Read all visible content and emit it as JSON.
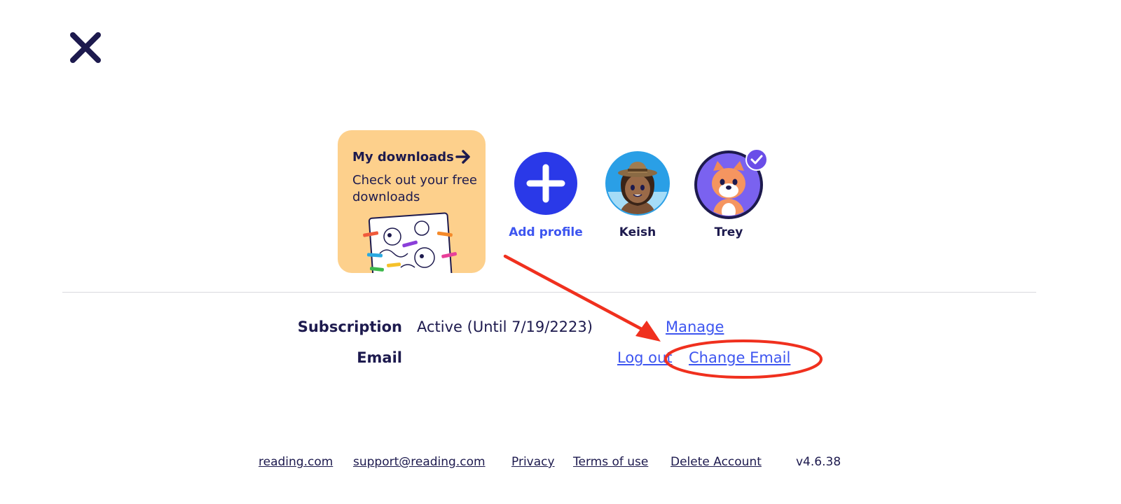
{
  "header": {
    "close_icon": "close-icon"
  },
  "downloads": {
    "title": "My downloads",
    "subtitle": "Check out your free downloads",
    "arrow_icon": "arrow-right-icon",
    "card_color": "#fdd08c"
  },
  "profiles": [
    {
      "label": "Add profile",
      "icon": "plus-icon"
    },
    {
      "label": "Keish",
      "icon": "avatar-keish"
    },
    {
      "label": "Trey",
      "icon": "avatar-trey",
      "selected": true
    }
  ],
  "account": {
    "subscription_label": "Subscription",
    "subscription_value": "Active (Until 7/19/2223)",
    "manage_link": "Manage",
    "email_label": "Email",
    "logout_link": "Log out",
    "change_email_link": "Change Email"
  },
  "footer": {
    "links": [
      "reading.com",
      "support@reading.com",
      "Privacy",
      "Terms of use",
      "Delete Account"
    ],
    "version": "v4.6.38"
  },
  "colors": {
    "navy": "#1d1a4e",
    "link_blue": "#3d55f0",
    "annotation_red": "#f0301e",
    "accent_purple": "#6a4de8"
  }
}
